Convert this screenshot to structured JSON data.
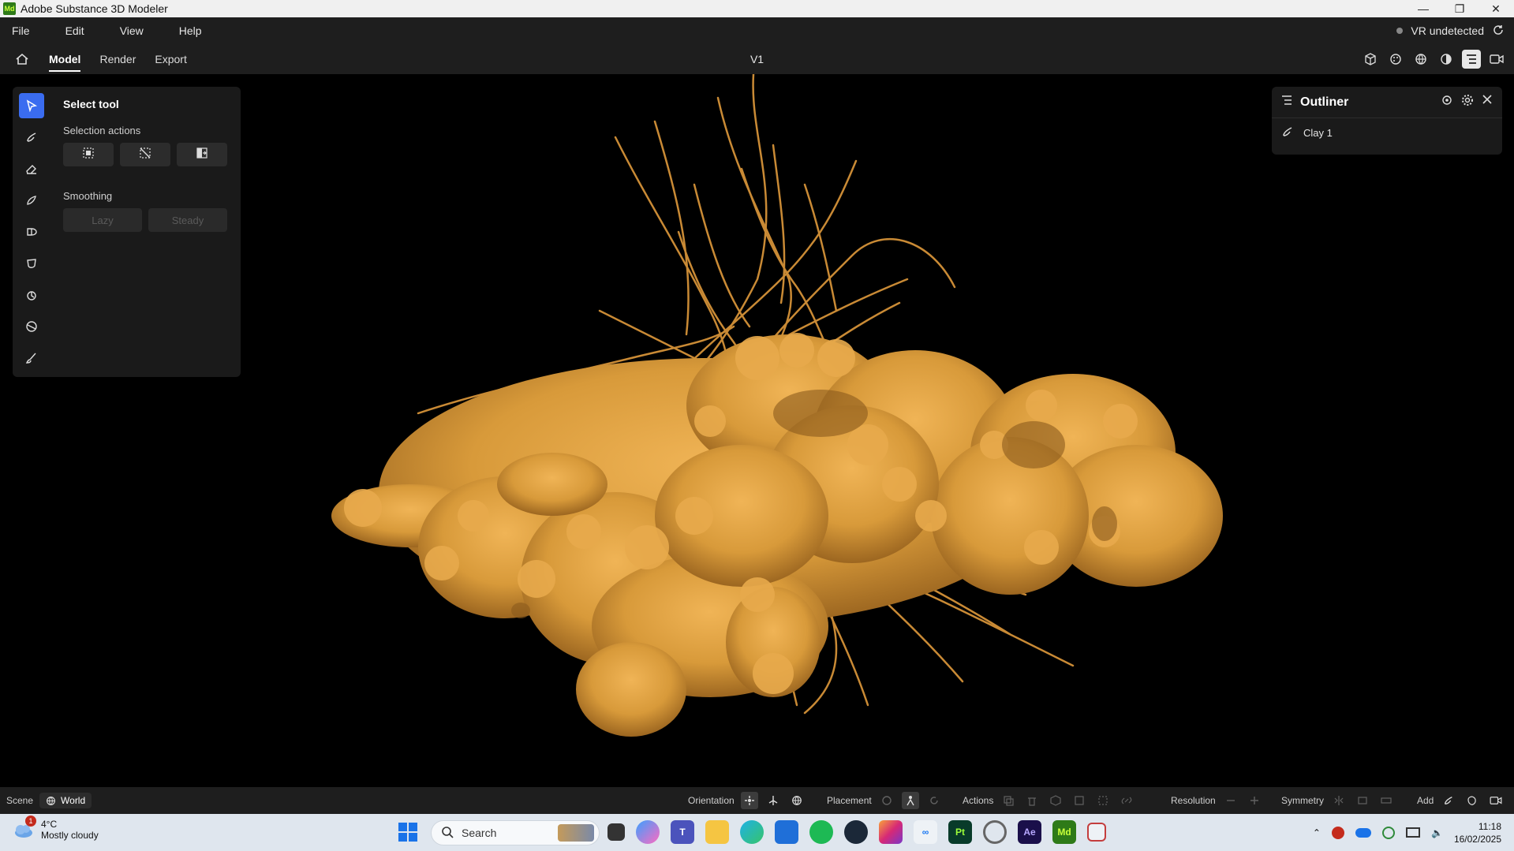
{
  "window": {
    "app_logo": "Md",
    "title": "Adobe Substance 3D Modeler",
    "controls": [
      "minimize-icon",
      "restore-icon",
      "close-icon"
    ]
  },
  "menubar": {
    "items": [
      "File",
      "Edit",
      "View",
      "Help"
    ],
    "vr_status": "VR undetected"
  },
  "tabs": {
    "items": [
      "Model",
      "Render",
      "Export"
    ],
    "active": "Model",
    "document_name": "V1"
  },
  "tool_panel": {
    "title": "Select tool",
    "selection_actions_label": "Selection actions",
    "smoothing_label": "Smoothing",
    "smoothing_options": [
      "Lazy",
      "Steady"
    ],
    "tools": [
      "select-icon",
      "clay-brush-icon",
      "eraser-icon",
      "smooth-icon",
      "move-icon",
      "inflate-icon",
      "pinch-icon",
      "flatten-icon",
      "paint-icon"
    ]
  },
  "outliner": {
    "title": "Outliner",
    "items": [
      {
        "label": "Clay 1"
      }
    ]
  },
  "statusbar": {
    "scene_label": "Scene",
    "world_label": "World",
    "orientation_label": "Orientation",
    "placement_label": "Placement",
    "actions_label": "Actions",
    "resolution_label": "Resolution",
    "symmetry_label": "Symmetry",
    "add_label": "Add"
  },
  "taskbar": {
    "weather_badge": "1",
    "temperature": "4°C",
    "weather_text": "Mostly cloudy",
    "search_placeholder": "Search",
    "time": "11:18",
    "date": "16/02/2025",
    "pinned": [
      "Pt",
      "Ae",
      "Md"
    ]
  },
  "colors": {
    "accent": "#3a6cf0",
    "clay": "#d89a3a",
    "panel": "#1a1a1a"
  }
}
